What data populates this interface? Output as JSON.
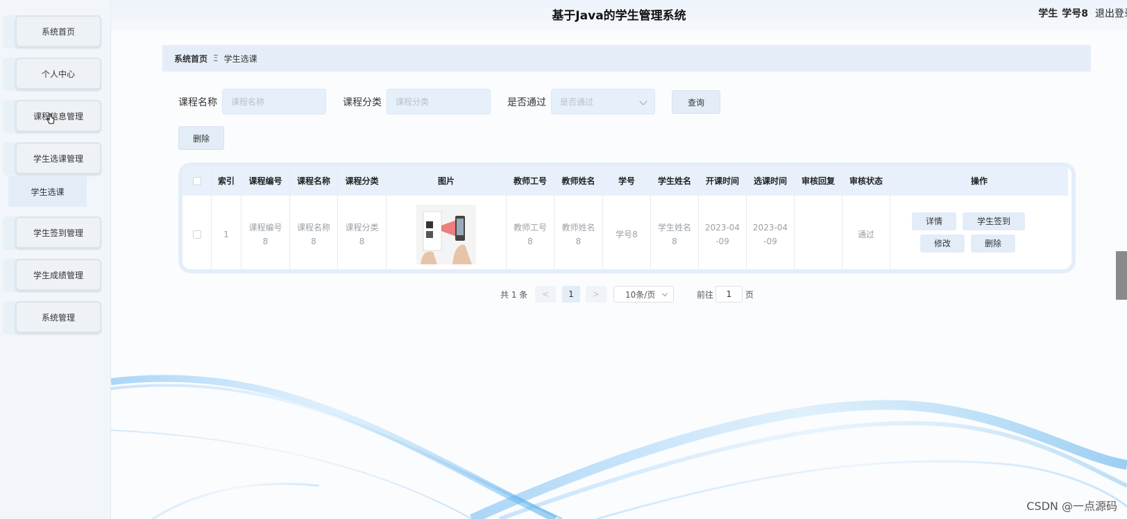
{
  "header": {
    "title": "基于Java的学生管理系统",
    "role": "学生",
    "username": "学号8",
    "logout": "退出登录"
  },
  "sidebar": {
    "items": [
      {
        "label": "系统首页"
      },
      {
        "label": "个人中心"
      },
      {
        "label": "课程信息管理"
      },
      {
        "label": "学生选课管理"
      },
      {
        "label": "学生签到管理"
      },
      {
        "label": "学生成绩管理"
      },
      {
        "label": "系统管理"
      }
    ],
    "subitem": "学生选课"
  },
  "breadcrumb": {
    "home": "系统首页",
    "separator": "Ξ",
    "current": "学生选课"
  },
  "search": {
    "course_name_label": "课程名称",
    "course_name_placeholder": "课程名称",
    "course_category_label": "课程分类",
    "course_category_placeholder": "课程分类",
    "approved_label": "是否通过",
    "approved_placeholder": "是否通过",
    "query_button": "查询"
  },
  "toolbar": {
    "delete_button": "删除"
  },
  "table": {
    "headers": [
      "",
      "索引",
      "课程编号",
      "课程名称",
      "课程分类",
      "图片",
      "教师工号",
      "教师姓名",
      "学号",
      "学生姓名",
      "开课时间",
      "选课时间",
      "审核回复",
      "审核状态",
      "操作"
    ],
    "rows": [
      {
        "index": "1",
        "course_no": "课程编号8",
        "course_name": "课程名称8",
        "course_category": "课程分类8",
        "teacher_no": "教师工号8",
        "teacher_name": "教师姓名8",
        "student_no": "学号8",
        "student_name": "学生姓名8",
        "start_time": "2023-04-09",
        "select_time": "2023-04-09",
        "review_reply": "",
        "review_status": "通过",
        "actions": {
          "detail": "详情",
          "checkin": "学生签到",
          "edit": "修改",
          "delete": "删除"
        }
      }
    ]
  },
  "pagination": {
    "total": "共 1 条",
    "prev": "<",
    "current_page": "1",
    "next": ">",
    "page_size": "10条/页",
    "goto_label": "前往",
    "goto_value": "1",
    "page_unit": "页"
  },
  "watermark": "CSDN @一点源码",
  "colors": {
    "accent_bg": "#e3edf8",
    "sidebar_bg": "#f2f6fb",
    "header_bg": "#eef4fb",
    "wave_blue": "#3aa0e6"
  }
}
